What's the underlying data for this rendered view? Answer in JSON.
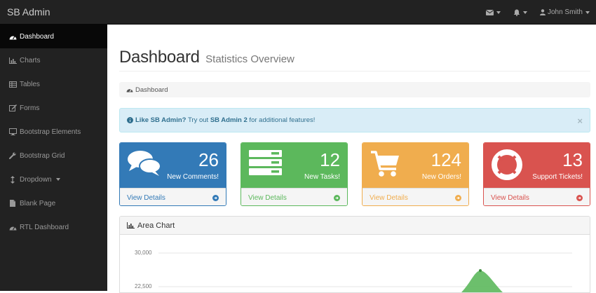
{
  "app": {
    "brand": "SB Admin"
  },
  "topnav": {
    "user_name": "John Smith",
    "icons": [
      "envelope-icon",
      "bell-icon",
      "user-icon"
    ]
  },
  "sidebar": {
    "items": [
      {
        "label": "Dashboard",
        "icon": "dashboard-icon",
        "active": true
      },
      {
        "label": "Charts",
        "icon": "bar-chart-icon"
      },
      {
        "label": "Tables",
        "icon": "table-icon"
      },
      {
        "label": "Forms",
        "icon": "edit-icon"
      },
      {
        "label": "Bootstrap Elements",
        "icon": "desktop-icon"
      },
      {
        "label": "Bootstrap Grid",
        "icon": "wrench-icon"
      },
      {
        "label": "Dropdown",
        "icon": "arrows-v-icon"
      },
      {
        "label": "Blank Page",
        "icon": "file-icon"
      },
      {
        "label": "RTL Dashboard",
        "icon": "dashboard-icon"
      }
    ]
  },
  "header": {
    "title": "Dashboard",
    "subtitle": "Statistics Overview"
  },
  "breadcrumb": {
    "label": "Dashboard"
  },
  "alert": {
    "lead": "Like SB Admin?",
    "text_before": " Try out ",
    "link": "SB Admin 2",
    "text_after": " for additional features!",
    "close": "×"
  },
  "panels": [
    {
      "count": "26",
      "label": "New Comments!",
      "footer": "View Details",
      "icon": "comments-icon",
      "color": "#337ab7"
    },
    {
      "count": "12",
      "label": "New Tasks!",
      "footer": "View Details",
      "icon": "tasks-icon",
      "color": "#5cb85c"
    },
    {
      "count": "124",
      "label": "New Orders!",
      "footer": "View Details",
      "icon": "shopping-cart-icon",
      "color": "#f0ad4e"
    },
    {
      "count": "13",
      "label": "Support Tickets!",
      "footer": "View Details",
      "icon": "life-ring-icon",
      "color": "#d9534f"
    }
  ],
  "area_chart": {
    "title": "Area Chart",
    "y_ticks": [
      "30,000",
      "22,500"
    ],
    "series_color": "#5cb85c"
  }
}
